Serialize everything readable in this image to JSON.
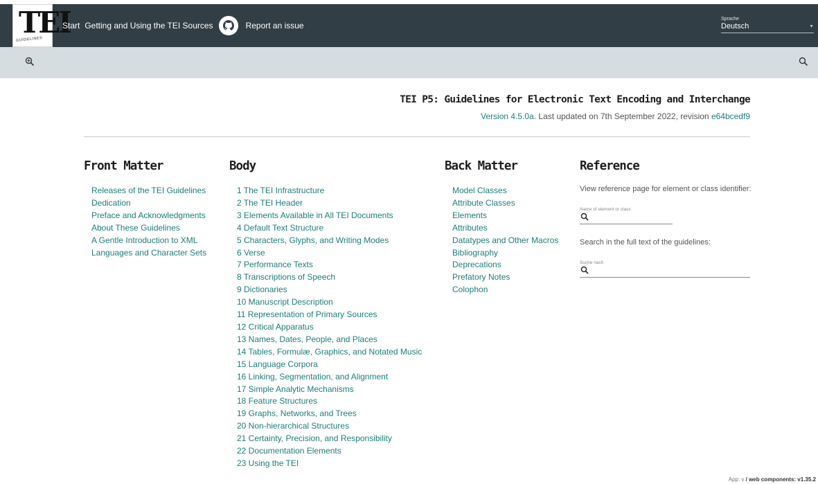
{
  "header": {
    "logo_text": "TEI",
    "logo_subtext": "GUIDELINES",
    "nav": [
      {
        "label": "Start"
      },
      {
        "label": "Getting and Using the TEI Sources"
      },
      {
        "label": "Report an issue"
      }
    ],
    "language_label": "Sprache",
    "language_value": "Deutsch"
  },
  "title": {
    "main": "TEI P5: Guidelines for Electronic Text Encoding and Interchange",
    "version_link": "Version 4.5.0a",
    "updated_text": ". Last updated on 7th September 2022, revision ",
    "revision_link": "e64bcedf9"
  },
  "columns": {
    "front": {
      "heading": "Front Matter",
      "items": [
        "Releases of the TEI Guidelines",
        "Dedication",
        "Preface and Acknowledgments",
        "About These Guidelines",
        "A Gentle Introduction to XML",
        "Languages and Character Sets"
      ]
    },
    "body": {
      "heading": "Body",
      "items": [
        "1 The TEI Infrastructure",
        "2 The TEI Header",
        "3 Elements Available in All TEI Documents",
        "4 Default Text Structure",
        "5 Characters, Glyphs, and Writing Modes",
        "6 Verse",
        "7 Performance Texts",
        "8 Transcriptions of Speech",
        "9 Dictionaries",
        "10 Manuscript Description",
        "11 Representation of Primary Sources",
        "12 Critical Apparatus",
        "13 Names, Dates, People, and Places",
        "14 Tables, Formulæ, Graphics, and Notated Music",
        "15 Language Corpora",
        "16 Linking, Segmentation, and Alignment",
        "17 Simple Analytic Mechanisms",
        "18 Feature Structures",
        "19 Graphs, Networks, and Trees",
        "20 Non-hierarchical Structures",
        "21 Certainty, Precision, and Responsibility",
        "22 Documentation Elements",
        "23 Using the TEI"
      ]
    },
    "back": {
      "heading": "Back Matter",
      "items": [
        "Model Classes",
        "Attribute Classes",
        "Elements",
        "Attributes",
        "Datatypes and Other Macros",
        "Bibliography",
        "Deprecations",
        "Prefatory Notes",
        "Colophon"
      ]
    },
    "reference": {
      "heading": "Reference",
      "view_text": "View reference page for element or class identifier:",
      "element_field_label": "Name of element or class",
      "search_text": "Search in the full text of the guidelines:",
      "search_field_label": "Suche nach"
    }
  },
  "footer": {
    "prefix": "App: v",
    "separator": " / ",
    "strong": "web components: v1.35.2"
  },
  "icons": {
    "github": "github-icon",
    "search": "search-icon",
    "zoom": "zoom-icon",
    "caret": "dropdown-caret-icon"
  },
  "colors": {
    "topbar": "#323e45",
    "searchbar": "#d6dde1",
    "link": "#1c7e7a"
  }
}
